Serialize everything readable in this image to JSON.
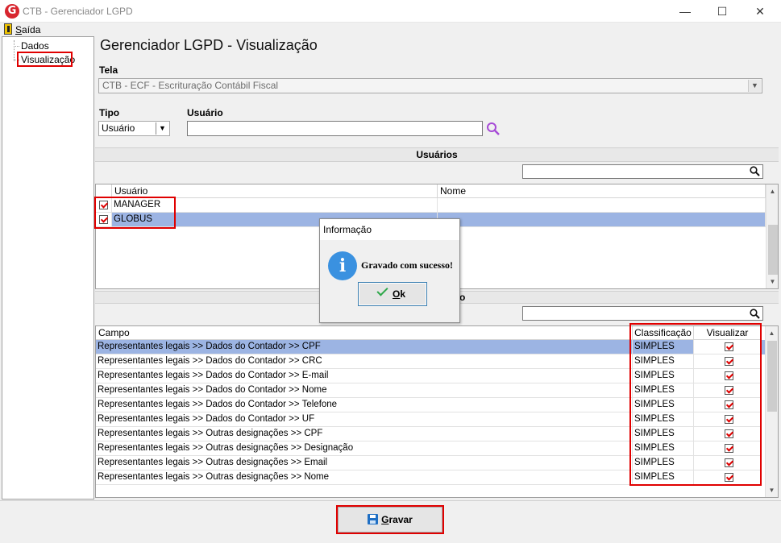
{
  "window": {
    "title": "CTB - Gerenciador LGPD",
    "app_icon_letter": "G",
    "minimize": "—",
    "maximize": "☐",
    "close": "✕"
  },
  "menu": {
    "exit_accel": "S",
    "exit_rest": "aída"
  },
  "tree": {
    "items": [
      "Dados",
      "Visualização"
    ]
  },
  "page": {
    "title": "Gerenciador LGPD - Visualização"
  },
  "tela": {
    "label": "Tela",
    "value": "CTB - ECF - Escrituração Contábil Fiscal"
  },
  "tipo": {
    "label": "Tipo",
    "value": "Usuário"
  },
  "usuario": {
    "label": "Usuário",
    "value": ""
  },
  "users_section": {
    "title": "Usuários",
    "columns": [
      "Usuário",
      "Nome"
    ],
    "rows": [
      {
        "usuario": "MANAGER",
        "nome": "",
        "checked": true
      },
      {
        "usuario": "GLOBUS",
        "nome": "",
        "checked": true
      }
    ]
  },
  "fields_section": {
    "title_visible_tail": "o",
    "columns": [
      "Campo",
      "Classificação",
      "Visualizar"
    ],
    "rows": [
      {
        "campo": "Representantes legais >> Dados do Contador >> CPF",
        "classificacao": "SIMPLES",
        "visualizar": true
      },
      {
        "campo": "Representantes legais >> Dados do Contador >> CRC",
        "classificacao": "SIMPLES",
        "visualizar": true
      },
      {
        "campo": "Representantes legais >> Dados do Contador >> E-mail",
        "classificacao": "SIMPLES",
        "visualizar": true
      },
      {
        "campo": "Representantes legais >> Dados do Contador >> Nome",
        "classificacao": "SIMPLES",
        "visualizar": true
      },
      {
        "campo": "Representantes legais >> Dados do Contador >> Telefone",
        "classificacao": "SIMPLES",
        "visualizar": true
      },
      {
        "campo": "Representantes legais >> Dados do Contador >> UF",
        "classificacao": "SIMPLES",
        "visualizar": true
      },
      {
        "campo": "Representantes legais >> Outras designações >> CPF",
        "classificacao": "SIMPLES",
        "visualizar": true
      },
      {
        "campo": "Representantes legais >> Outras designações >> Designação",
        "classificacao": "SIMPLES",
        "visualizar": true
      },
      {
        "campo": "Representantes legais >> Outras designações >> Email",
        "classificacao": "SIMPLES",
        "visualizar": true
      },
      {
        "campo": "Representantes legais >> Outras designações >> Nome",
        "classificacao": "SIMPLES",
        "visualizar": true
      }
    ]
  },
  "dialog": {
    "title": "Informação",
    "icon_letter": "i",
    "message": "Gravado com sucesso!",
    "ok_accel": "O",
    "ok_rest": "k"
  },
  "save": {
    "accel": "G",
    "rest": "ravar"
  },
  "colors": {
    "selection": "#9cb4e3",
    "highlight_box": "#e00000",
    "info_icon": "#3a91e0",
    "check": "#d00000"
  }
}
